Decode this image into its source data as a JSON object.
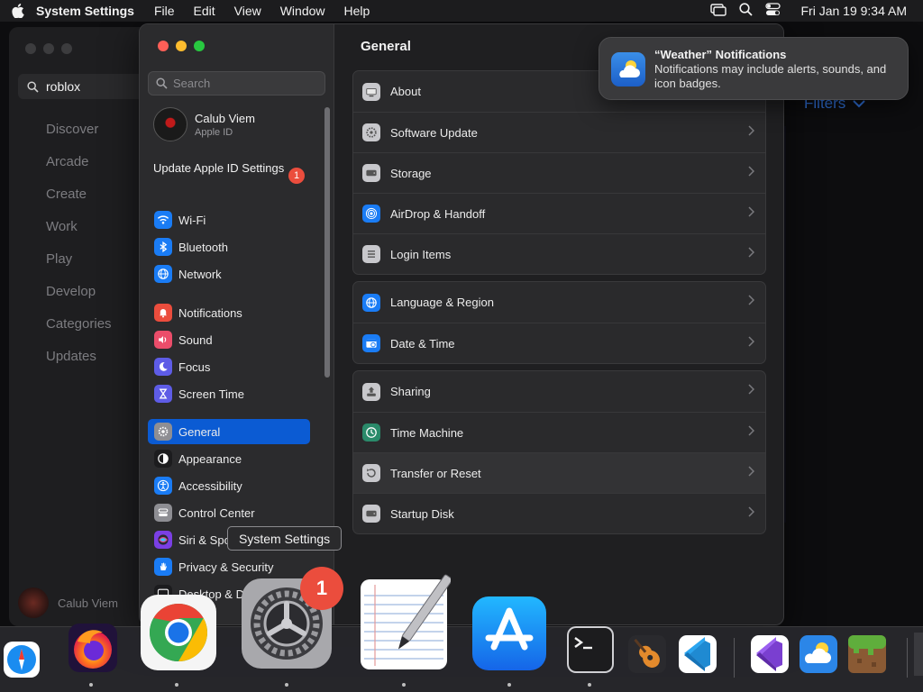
{
  "menubar": {
    "app_name": "System Settings",
    "menus": [
      "File",
      "Edit",
      "View",
      "Window",
      "Help"
    ],
    "clock": "Fri Jan 19  9:34 AM"
  },
  "background_app": {
    "search_value": "roblox",
    "nav": [
      "Discover",
      "Arcade",
      "Create",
      "Work",
      "Play",
      "Develop",
      "Categories",
      "Updates"
    ],
    "user_name": "Calub Viem",
    "filters_label": "Filters"
  },
  "settings": {
    "search_placeholder": "Search",
    "apple_id": {
      "name": "Calub Viem",
      "subtitle": "Apple ID"
    },
    "update_apple_id": {
      "label": "Update Apple ID Settings",
      "badge": "1"
    },
    "sidebar": [
      {
        "label": "Wi-Fi",
        "icon": "wifi-icon",
        "color": "#1a7cf5"
      },
      {
        "label": "Bluetooth",
        "icon": "bluetooth-icon",
        "color": "#1a7cf5"
      },
      {
        "label": "Network",
        "icon": "globe-icon",
        "color": "#1a7cf5"
      },
      {
        "label": "Notifications",
        "icon": "bell-icon",
        "color": "#eb4d3d"
      },
      {
        "label": "Sound",
        "icon": "speaker-icon",
        "color": "#eb4d6a"
      },
      {
        "label": "Focus",
        "icon": "moon-icon",
        "color": "#5e5ce6"
      },
      {
        "label": "Screen Time",
        "icon": "hourglass-icon",
        "color": "#5e5ce6"
      },
      {
        "label": "General",
        "icon": "gear-icon",
        "color": "#8e8e93"
      },
      {
        "label": "Appearance",
        "icon": "appearance-icon",
        "color": "#1c1c1e"
      },
      {
        "label": "Accessibility",
        "icon": "accessibility-icon",
        "color": "#1a7cf5"
      },
      {
        "label": "Control Center",
        "icon": "control-center-icon",
        "color": "#8e8e93"
      },
      {
        "label": "Siri & Spotlight",
        "icon": "siri-icon",
        "color": "#7b3fe4"
      },
      {
        "label": "Privacy & Security",
        "icon": "hand-icon",
        "color": "#1a7cf5"
      },
      {
        "label": "Desktop & Dock",
        "icon": "dock-icon",
        "color": "#1c1c1e"
      }
    ],
    "selected": "General",
    "content_title": "General",
    "groups": [
      [
        {
          "label": "About",
          "icon": "about-icon"
        },
        {
          "label": "Software Update",
          "icon": "software-update-icon"
        },
        {
          "label": "Storage",
          "icon": "storage-icon"
        },
        {
          "label": "AirDrop & Handoff",
          "icon": "airdrop-icon"
        },
        {
          "label": "Login Items",
          "icon": "login-items-icon"
        }
      ],
      [
        {
          "label": "Language & Region",
          "icon": "language-icon"
        },
        {
          "label": "Date & Time",
          "icon": "date-time-icon"
        }
      ],
      [
        {
          "label": "Sharing",
          "icon": "sharing-icon"
        },
        {
          "label": "Time Machine",
          "icon": "time-machine-icon"
        },
        {
          "label": "Transfer or Reset",
          "icon": "transfer-reset-icon"
        },
        {
          "label": "Startup Disk",
          "icon": "startup-disk-icon"
        }
      ]
    ]
  },
  "notification": {
    "title": "“Weather” Notifications",
    "body": "Notifications may include alerts, sounds, and icon badges."
  },
  "tooltip": "System Settings",
  "dock": {
    "apps": [
      "Safari",
      "Firefox",
      "Google Chrome",
      "System Settings",
      "TextEdit",
      "App Store",
      "Terminal",
      "GarageBand",
      "Visual Studio Code",
      "Visual Studio",
      "Weather",
      "Minecraft"
    ],
    "badge": "1"
  }
}
